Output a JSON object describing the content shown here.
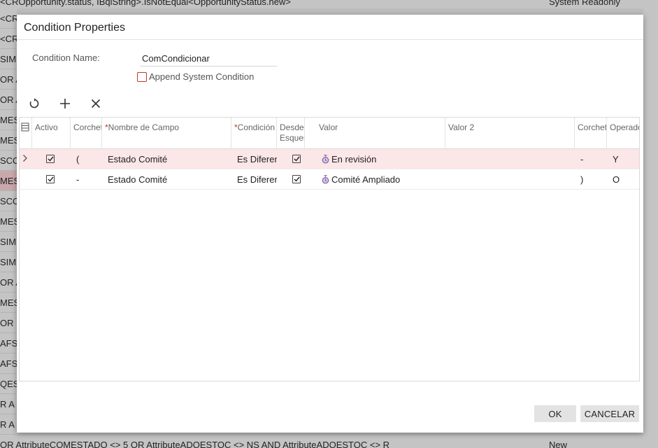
{
  "background": {
    "top_text": "<CROpportunity.status, IBqlString>.IsNotEqual<OpportunityStatus.new>",
    "top_right_text": "System Readonly",
    "side_rows": [
      "<CR",
      "<CR",
      "SIMB",
      "OR A",
      "OR A",
      "MES",
      "MES",
      "SCO",
      "MES",
      "SCO",
      "MES",
      "SIMB",
      "SIMB",
      "OR A",
      "MES",
      "OR",
      "AFS",
      "AFS",
      "QES",
      "R A",
      "R A"
    ],
    "bottom_text": "OR AttributeCOMESTADO <> 5 OR AttributeADQESTOC <> NS AND AttributeADQESTOC <> R",
    "bottom_right_text": "New"
  },
  "dialog": {
    "title": "Condition Properties",
    "condition_name_label": "Condition Name:",
    "condition_name_value": "ComCondicionar",
    "append_label": "Append System Condition"
  },
  "toolbar": {
    "refresh_icon": "refresh-icon",
    "add_icon": "plus-icon",
    "delete_icon": "close-icon"
  },
  "grid": {
    "columns": [
      {
        "label": "Activo",
        "required": false
      },
      {
        "label": "Corchete",
        "required": false
      },
      {
        "label": "Nombre de Campo",
        "required": true
      },
      {
        "label": "Condición",
        "required": true
      },
      {
        "label": "Desde Esquema",
        "required": false
      },
      {
        "label": "Valor",
        "required": false
      },
      {
        "label": "Valor 2",
        "required": false
      },
      {
        "label": "Corchete",
        "required": false
      },
      {
        "label": "Operador",
        "required": false
      }
    ],
    "rows": [
      {
        "active": true,
        "open_bracket": "(",
        "field": "Estado Comité",
        "condition": "Es Diferente",
        "from_schema": true,
        "value": "En revisión",
        "value2": "",
        "close_bracket": "-",
        "operator": "Y"
      },
      {
        "active": true,
        "open_bracket": "-",
        "field": "Estado Comité",
        "condition": "Es Diferente",
        "from_schema": true,
        "value": "Comité Ampliado",
        "value2": "",
        "close_bracket": ")",
        "operator": "O"
      }
    ]
  },
  "buttons": {
    "ok": "OK",
    "cancel": "CANCELAR"
  },
  "colors": {
    "accent_red": "#c0392b",
    "selected_row": "#fbe6e8"
  }
}
